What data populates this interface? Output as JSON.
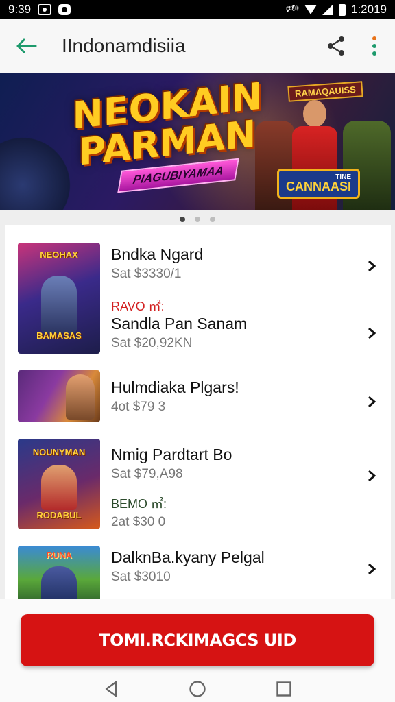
{
  "status_bar": {
    "time_left": "9:39",
    "time_right": "1:2019"
  },
  "app_bar": {
    "title": "IIndonamdisiia"
  },
  "banner": {
    "title_line1": "NEOKAIN",
    "title_line2": "PARMAN",
    "ribbon": "PIAGUBIYAMAA",
    "badge_top": "RAMAQAUISS",
    "badge_small": "TINE",
    "badge_main": "CANNAASI"
  },
  "carousel": {
    "pages": 3,
    "active": 0
  },
  "list": {
    "items": [
      {
        "thumb_label_top": "NEOHAX",
        "thumb_label_bottom": "BAMASAS",
        "title": "Bndka Ngard",
        "subtitle": "Sat $3330/1",
        "tag": "RAVO ㎡:",
        "title2": "Sandla Pan Sanam",
        "subtitle2": "Sat $20,92KN"
      },
      {
        "thumb_label_top": "",
        "thumb_label_bottom": "",
        "title": "Hulmdiaka Plgars!",
        "subtitle": "4ot $79 3"
      },
      {
        "thumb_label_top": "NOUNYMAN",
        "thumb_label_bottom": "RODABUL",
        "title": "Nmig Pardtart Bo",
        "subtitle": "Sat $79,A98",
        "tag": "BEMO ㎡:",
        "title2": "",
        "subtitle2": "2at $30 0"
      },
      {
        "thumb_label_top": "RUNA",
        "thumb_label_bottom": "",
        "title": "DalknBa.kyany Pelgal",
        "subtitle": "Sat $3010"
      }
    ]
  },
  "cta": {
    "label": "TOMI.RCKIMAGCS UID"
  },
  "colors": {
    "accent_green": "#1d9a6c",
    "cta_red": "#d61313"
  }
}
